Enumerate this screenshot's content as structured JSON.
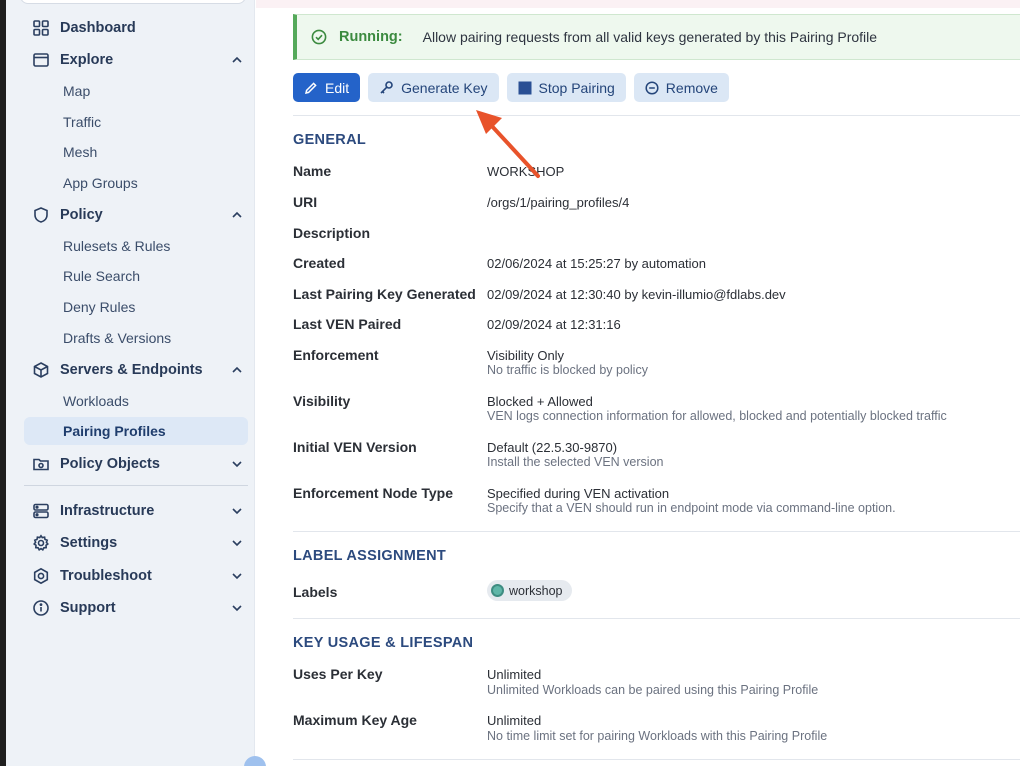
{
  "sidebar": {
    "sections": {
      "dashboard": "Dashboard",
      "explore": "Explore",
      "policy": "Policy",
      "servers": "Servers & Endpoints",
      "policy_objects": "Policy Objects",
      "infrastructure": "Infrastructure",
      "settings": "Settings",
      "troubleshoot": "Troubleshoot",
      "support": "Support"
    },
    "explore_items": [
      "Map",
      "Traffic",
      "Mesh",
      "App Groups"
    ],
    "policy_items": [
      "Rulesets & Rules",
      "Rule Search",
      "Deny Rules",
      "Drafts & Versions"
    ],
    "servers_items": [
      "Workloads",
      "Pairing Profiles"
    ]
  },
  "banner": {
    "status": "Running:",
    "message": "Allow pairing requests from all valid keys generated by this Pairing Profile"
  },
  "toolbar": {
    "edit": "Edit",
    "generate_key": "Generate Key",
    "stop_pairing": "Stop Pairing",
    "remove": "Remove"
  },
  "general": {
    "title": "GENERAL",
    "name_label": "Name",
    "name_value": "WORKSHOP",
    "uri_label": "URI",
    "uri_value": "/orgs/1/pairing_profiles/4",
    "description_label": "Description",
    "created_label": "Created",
    "created_value": "02/06/2024 at 15:25:27 by automation",
    "last_key_label": "Last Pairing Key Generated",
    "last_key_value": "02/09/2024 at 12:30:40 by kevin-illumio@fdlabs.dev",
    "last_ven_label": "Last VEN Paired",
    "last_ven_value": "02/09/2024 at 12:31:16",
    "enforcement_label": "Enforcement",
    "enforcement_value": "Visibility Only",
    "enforcement_sub": "No traffic is blocked by policy",
    "visibility_label": "Visibility",
    "visibility_value": "Blocked + Allowed",
    "visibility_sub": "VEN logs connection information for allowed, blocked and potentially blocked traffic",
    "initial_ven_label": "Initial VEN Version",
    "initial_ven_value": "Default (22.5.30-9870)",
    "initial_ven_sub": "Install the selected VEN version",
    "node_type_label": "Enforcement Node Type",
    "node_type_value": "Specified during VEN activation",
    "node_type_sub": "Specify that a VEN should run in endpoint mode via command-line option."
  },
  "labels_section": {
    "title": "LABEL ASSIGNMENT",
    "labels_label": "Labels",
    "chip": "workshop"
  },
  "key_usage": {
    "title": "KEY USAGE & LIFESPAN",
    "uses_label": "Uses Per Key",
    "uses_value": "Unlimited",
    "uses_sub": "Unlimited Workloads can be paired using this Pairing Profile",
    "max_age_label": "Maximum Key Age",
    "max_age_value": "Unlimited",
    "max_age_sub": "No time limit set for pairing Workloads with this Pairing Profile"
  },
  "colors": {
    "primary": "#2463c9",
    "running_green": "#3b8a3f",
    "annotation_arrow": "#e8532b"
  }
}
